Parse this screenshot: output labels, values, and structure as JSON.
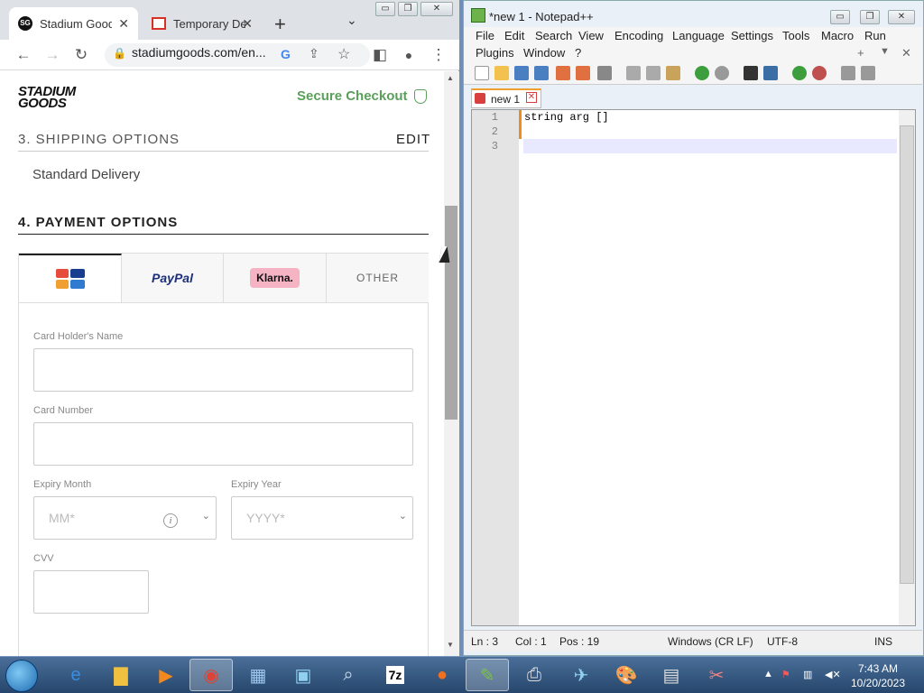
{
  "chrome": {
    "tabs": [
      {
        "title": "Stadium Goods",
        "close": "✕"
      },
      {
        "title": "Temporary De",
        "close": "✕"
      }
    ],
    "new_tab": "+",
    "tab_dropdown": "⌄",
    "url": "stadiumgoods.com/en...",
    "window_buttons": [
      "▭",
      "❐",
      "✕"
    ]
  },
  "page": {
    "logo": "STADIUM GOODS",
    "secure_checkout": "Secure Checkout",
    "shipping": {
      "title": "3. SHIPPING OPTIONS",
      "edit": "EDIT",
      "selected": "Standard Delivery"
    },
    "payment": {
      "title": "4. PAYMENT OPTIONS",
      "tabs": {
        "paypal": "PayPal",
        "klarna": "Klarna.",
        "other": "OTHER"
      },
      "fields": {
        "name_label": "Card Holder's Name",
        "number_label": "Card Number",
        "expiry_month_label": "Expiry Month",
        "expiry_month_value": "MM*",
        "expiry_year_label": "Expiry Year",
        "expiry_year_value": "YYYY*",
        "cvv_label": "CVV",
        "info": "i"
      }
    }
  },
  "notepad": {
    "title": "*new 1 - Notepad++",
    "menu": [
      "File",
      "Edit",
      "Search",
      "View",
      "Encoding",
      "Language",
      "Settings",
      "Tools",
      "Macro",
      "Run",
      "Plugins",
      "Window",
      "?"
    ],
    "menu_extra": [
      "+",
      "▼",
      "✕"
    ],
    "tab": "new 1",
    "lines": [
      "1",
      "2",
      "3"
    ],
    "code": "string arg []",
    "status": {
      "ln": "Ln : 3",
      "col": "Col : 1",
      "pos": "Pos : 19",
      "eol": "Windows (CR LF)",
      "encoding": "UTF-8",
      "mode": "INS"
    }
  },
  "taskbar": {
    "time": "7:43 AM",
    "date": "10/20/2023",
    "apps": [
      "ie-icon",
      "explorer-icon",
      "media-player-icon",
      "chrome-icon",
      "control-panel-icon",
      "network-icon",
      "magnifier-icon",
      "7zip-icon",
      "firefox-icon",
      "notepadpp-icon",
      "printer-icon",
      "mail-icon",
      "paint-icon",
      "calculator-icon",
      "tools-icon"
    ],
    "seven_zip": "7z"
  }
}
